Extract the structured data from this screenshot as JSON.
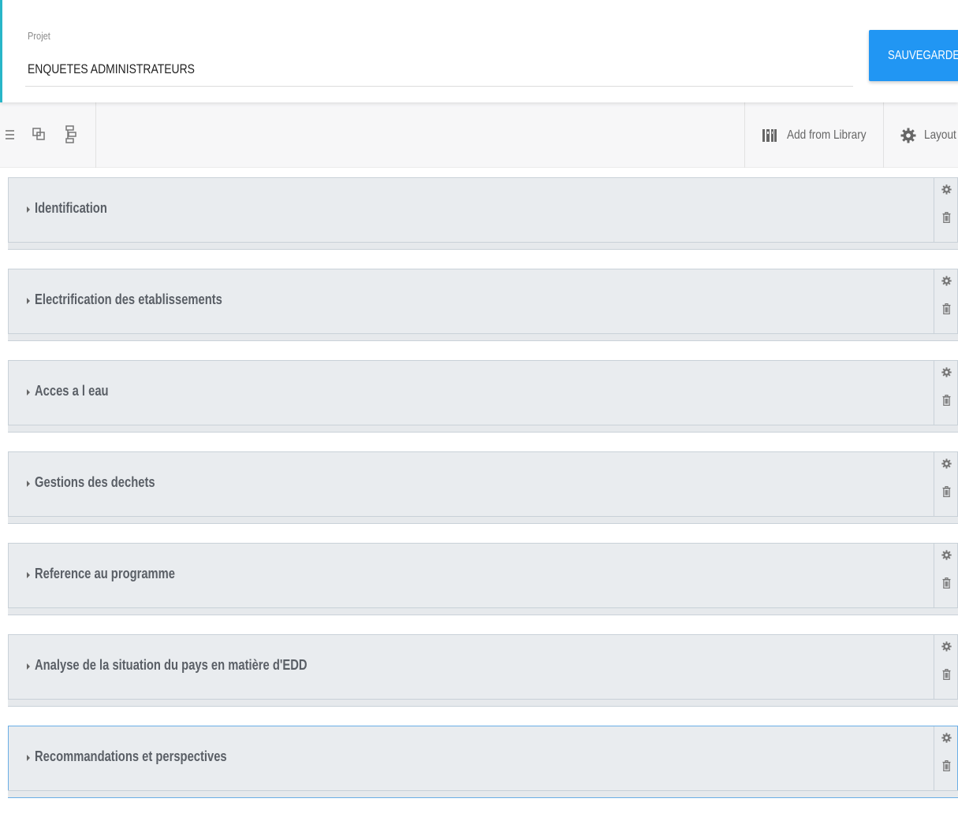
{
  "header": {
    "project_label": "Projet",
    "project_value": "ENQUETES ADMINISTRATEURS",
    "save_label": "SAUVEGARDER"
  },
  "toolbar": {
    "icons": [
      "list-icon",
      "duplicate-icon",
      "tree-structure-icon"
    ],
    "add_from_library_label": "Add from Library",
    "add_from_library_icon": "library-books-icon",
    "layout_label": "Layout",
    "layout_icon": "gear-icon"
  },
  "sections": [
    {
      "title": "Identification",
      "active": false
    },
    {
      "title": "Electrification des etablissements",
      "active": false
    },
    {
      "title": "Acces a l eau",
      "active": false
    },
    {
      "title": "Gestions des dechets",
      "active": false
    },
    {
      "title": "Reference au programme",
      "active": false
    },
    {
      "title": "Analyse de la situation du pays en matière d'EDD",
      "active": false
    },
    {
      "title": "Recommandations et perspectives",
      "active": true
    }
  ],
  "colors": {
    "accent": "#2196f3",
    "header_left_border": "#29b6c8",
    "section_bg": "#e9ecef",
    "section_border": "#c9d1d8",
    "active_border": "#6aaee6"
  }
}
